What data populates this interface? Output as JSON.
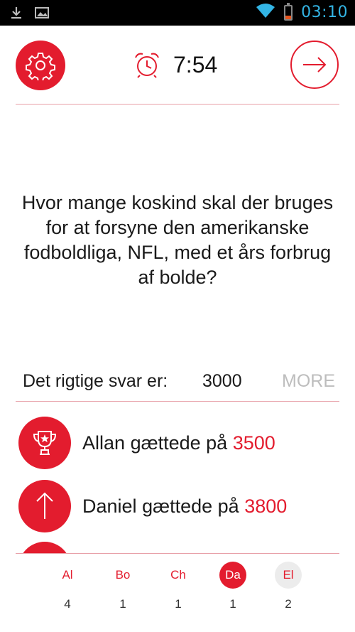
{
  "status_bar": {
    "time": "03:10",
    "icons": [
      "download-icon",
      "image-icon",
      "wifi-icon",
      "battery-icon"
    ],
    "battery_level": 0.25
  },
  "header": {
    "settings_icon": "gear-icon",
    "alarm_icon": "alarm-clock-icon",
    "timer": "7:54",
    "next_icon": "arrow-right-icon"
  },
  "question": "Hvor mange koskind skal der bruges for at forsyne den amerikanske fodboldliga, NFL, med et års forbrug af bolde?",
  "answer": {
    "label": "Det rigtige svar er:",
    "value": "3000",
    "more_label": "MORE"
  },
  "guesses": [
    {
      "icon": "trophy-icon",
      "name": "Allan",
      "verb": "gættede på",
      "value": "3500"
    },
    {
      "icon": "arrow-up-icon",
      "name": "Daniel",
      "verb": "gættede på",
      "value": "3800"
    }
  ],
  "players": [
    {
      "abbr": "Al",
      "score": "4",
      "state": "normal"
    },
    {
      "abbr": "Bo",
      "score": "1",
      "state": "normal"
    },
    {
      "abbr": "Ch",
      "score": "1",
      "state": "normal"
    },
    {
      "abbr": "Da",
      "score": "1",
      "state": "active"
    },
    {
      "abbr": "El",
      "score": "2",
      "state": "dim"
    }
  ],
  "colors": {
    "accent": "#e31c2e",
    "status_blue": "#33b5e5",
    "divider": "#e8a0a8",
    "muted": "#bdbdbd"
  }
}
